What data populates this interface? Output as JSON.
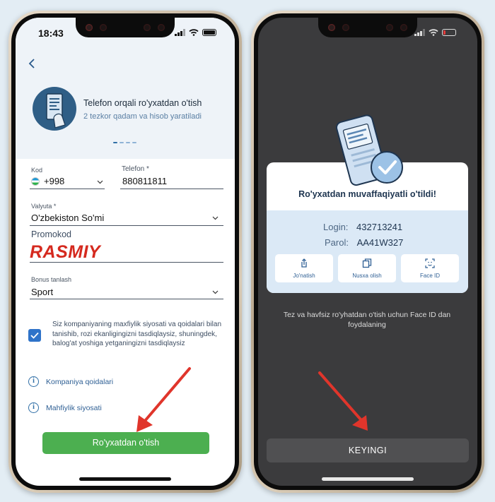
{
  "left_screen": {
    "status_time": "18:43",
    "hero": {
      "title": "Telefon orqali ro'yxatdan o'tish",
      "subtitle": "2 tezkor qadam va hisob yaratiladi"
    },
    "form": {
      "code_label": "Kod",
      "code_value": "+998",
      "phone_label": "Telefon *",
      "phone_value": "880811811",
      "currency_label": "Valyuta *",
      "currency_value": "O'zbekiston So'mi",
      "promo_label": "Promokod",
      "promo_value": "RASMIY",
      "bonus_label": "Bonus tanlash",
      "bonus_value": "Sport"
    },
    "consent_text": "Siz kompaniyaning maxfiylik siyosati va qoidalari bilan tanishib, rozi ekanligingizni tasdiqlaysiz, shuningdek, balog'at yoshiga yetganingizni tasdiqlaysiz",
    "consent_checked": true,
    "links": {
      "rules": "Kompaniya qoidalari",
      "privacy": "Mahfiylik siyosati"
    },
    "register_button": "Ro'yxatdan o'tish"
  },
  "right_screen": {
    "success_title": "Ro'yxatdan muvaffaqiyatli o'tildi!",
    "login_label": "Login:",
    "login_value": "432713241",
    "password_label": "Parol:",
    "password_value": "AA41W327",
    "actions": {
      "send": "Jo'natish",
      "copy": "Nusxa olish",
      "faceid": "Face ID"
    },
    "hint": "Tez va havfsiz ro'yhatdan o'tish uchun Face ID dan foydalaning",
    "next_button": "KEYINGI"
  },
  "colors": {
    "accent_green": "#4caf50",
    "arrow_red": "#e0352b",
    "primary_blue": "#2f73c9"
  }
}
